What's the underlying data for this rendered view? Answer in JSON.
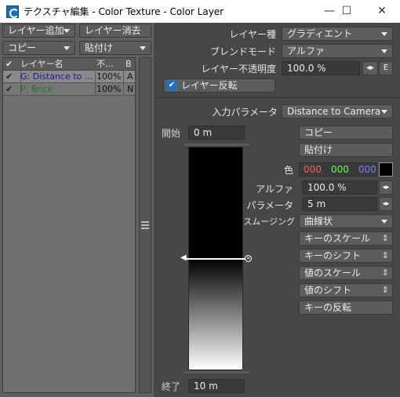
{
  "window": {
    "title": "テクスチャ編集 - Color Texture - Color Layer",
    "minimize": "—",
    "maximize": "☐",
    "close": "✕"
  },
  "left": {
    "add_layer": "レイヤー追加",
    "delete_layer": "レイヤー消去",
    "copy": "コピー",
    "paste": "貼付け",
    "columns": [
      "レイヤー名",
      "不…",
      "B"
    ],
    "layers": [
      {
        "name": "G: Distance to …",
        "opacity": "100%",
        "blend": "A",
        "color": "#1a1aa0"
      },
      {
        "name": "P: Brick",
        "opacity": "100%",
        "blend": "N",
        "color": "#1e7a1e"
      }
    ]
  },
  "right": {
    "layer_type_label": "レイヤー種",
    "layer_type": "グラディエント",
    "blend_mode_label": "ブレンドモード",
    "blend_mode": "アルファ",
    "opacity_label": "レイヤー不透明度",
    "opacity": "100.0 %",
    "e_button": "E",
    "invert_layer": "レイヤー反転",
    "input_param_label": "入力パラメータ",
    "input_param": "Distance to Camera",
    "start_label": "開始",
    "start_value": "0 m",
    "end_label": "終了",
    "end_value": "10 m",
    "copy": "コピー",
    "paste": "貼付け",
    "color_label": "色",
    "color_r": "000",
    "color_g": "000",
    "color_b": "000",
    "alpha_label": "アルファ",
    "alpha": "100.0 %",
    "param_label": "パラメータ",
    "param": "5 m",
    "smoothing_label": "スムージング",
    "smoothing": "曲線状",
    "key_scale": "キーのスケール",
    "key_shift": "キーのシフト",
    "value_scale": "値のスケール",
    "value_shift": "値のシフト",
    "key_invert": "キーの反転",
    "swatch_color": "#000000",
    "key_position": 0.5
  }
}
